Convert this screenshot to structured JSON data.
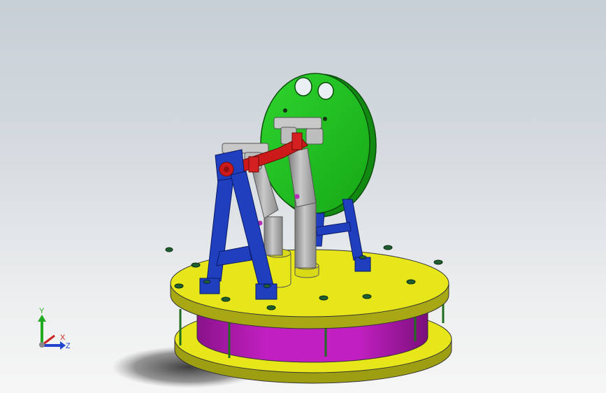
{
  "viewport": {
    "colors": {
      "flywheel": "#1fbf1f",
      "frame": "#1f3fbf",
      "plate": "#e6e61a",
      "chamber": "#c21fc2",
      "crank": "#cc1a1a",
      "cylinder": "#a8a8a8",
      "rod": "#2f8f2f"
    }
  },
  "triad": {
    "x_label": "X",
    "y_label": "Y",
    "z_label": "Z",
    "colors": {
      "x": "#cc2222",
      "y": "#22aa22",
      "z": "#2244cc"
    }
  }
}
